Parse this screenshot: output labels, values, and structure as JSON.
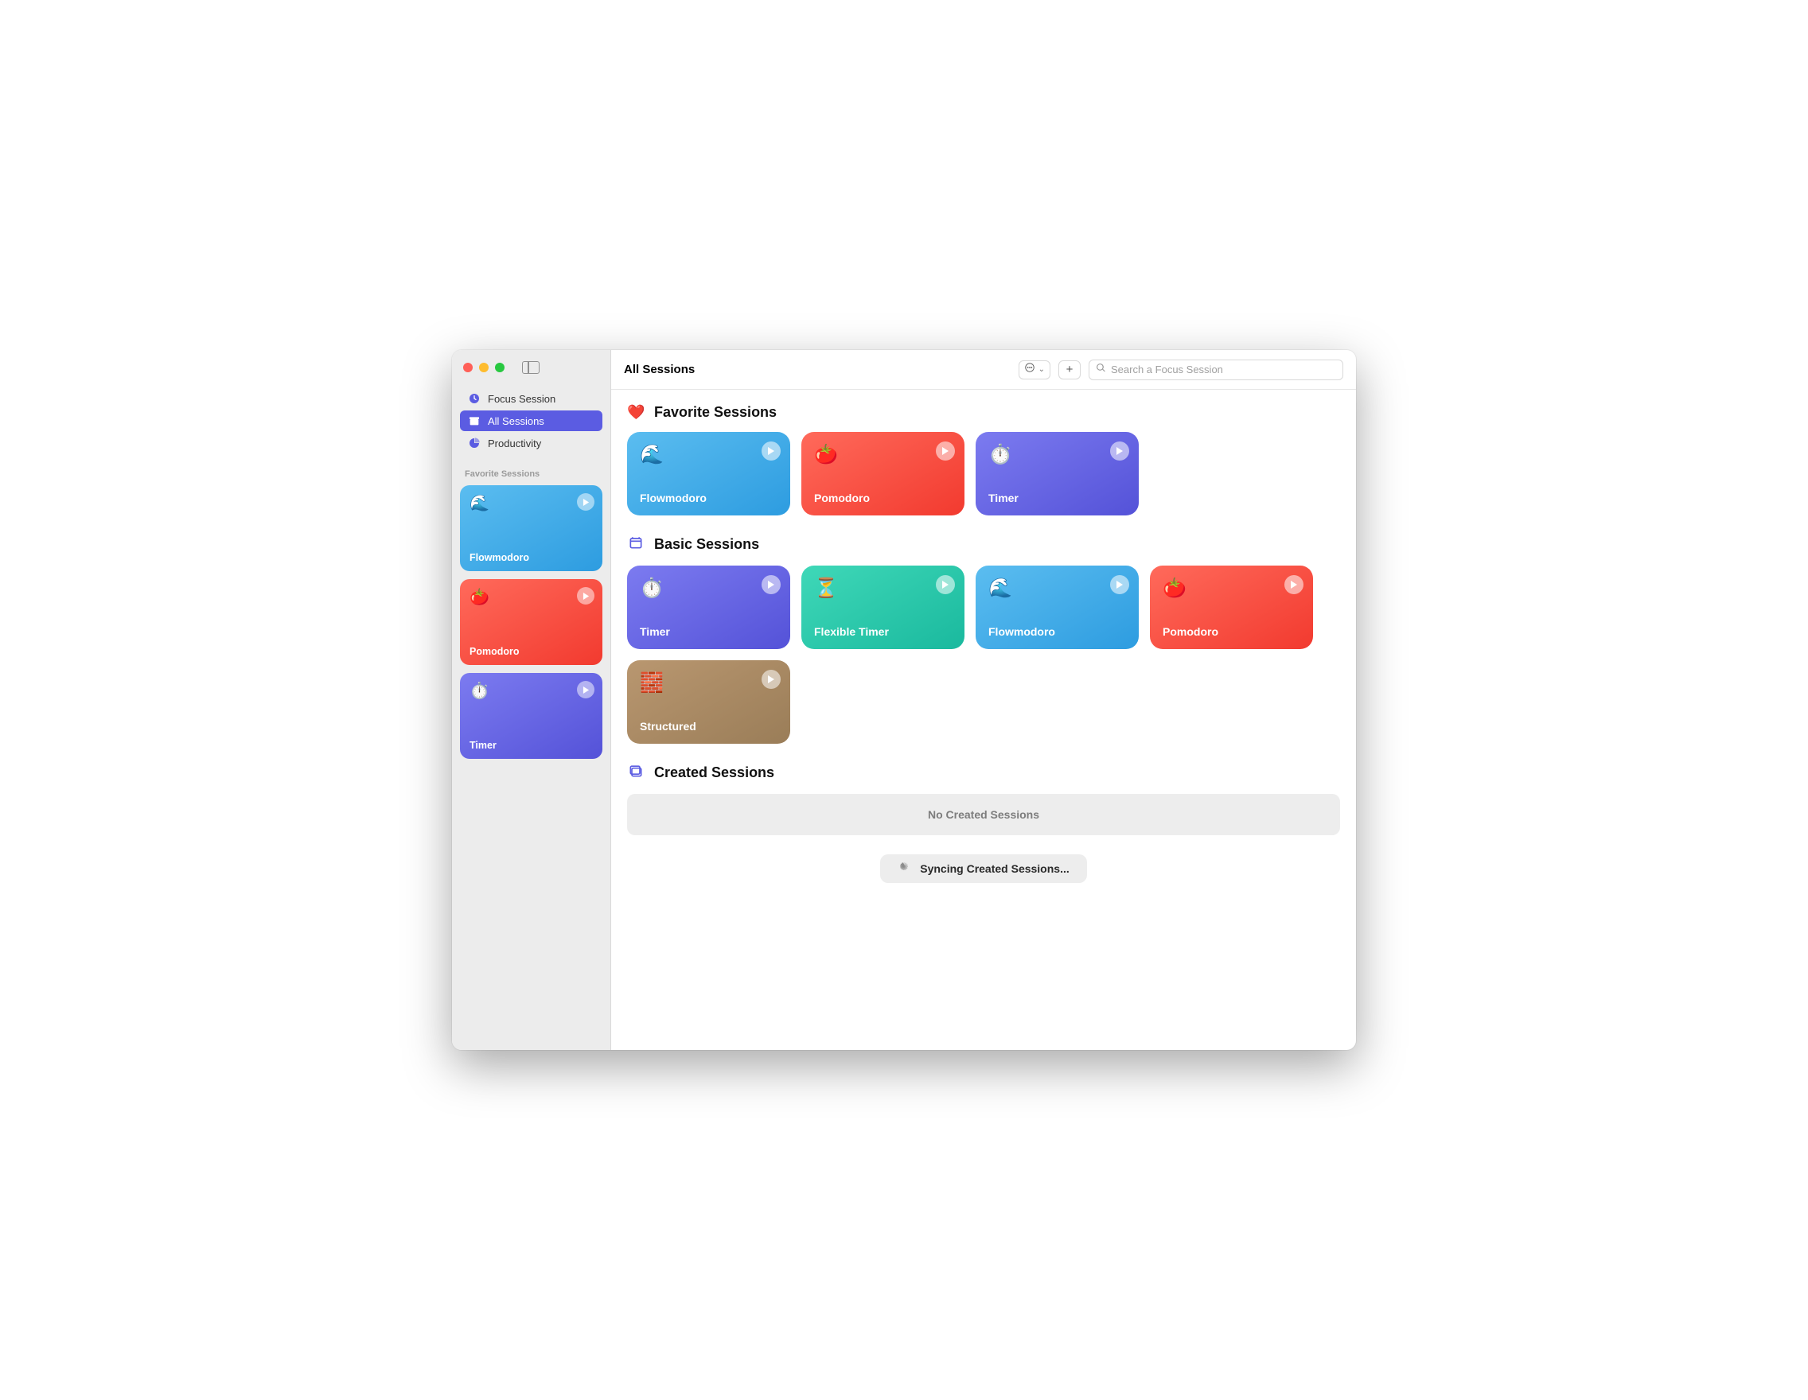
{
  "window": {
    "title": "All Sessions"
  },
  "toolbar": {
    "search_placeholder": "Search a Focus Session"
  },
  "sidebar": {
    "nav": [
      {
        "label": "Focus Session",
        "icon": "clock"
      },
      {
        "label": "All Sessions",
        "icon": "archivebox",
        "active": true
      },
      {
        "label": "Productivity",
        "icon": "piechart"
      }
    ],
    "favorites_header": "Favorite Sessions",
    "favorites": [
      {
        "label": "Flowmodoro",
        "emoji": "🌊",
        "gradient": "g-blue"
      },
      {
        "label": "Pomodoro",
        "emoji": "🍅",
        "gradient": "g-red"
      },
      {
        "label": "Timer",
        "emoji": "⏱️",
        "gradient": "g-indigo"
      }
    ]
  },
  "sections": {
    "favorite": {
      "title": "Favorite Sessions",
      "icon": "heart",
      "cards": [
        {
          "label": "Flowmodoro",
          "emoji": "🌊",
          "gradient": "g-blue"
        },
        {
          "label": "Pomodoro",
          "emoji": "🍅",
          "gradient": "g-red"
        },
        {
          "label": "Timer",
          "emoji": "⏱️",
          "gradient": "g-indigo"
        }
      ]
    },
    "basic": {
      "title": "Basic Sessions",
      "icon": "browser",
      "cards": [
        {
          "label": "Timer",
          "emoji": "⏱️",
          "gradient": "g-indigo"
        },
        {
          "label": "Flexible Timer",
          "emoji": "⏳",
          "gradient": "g-teal"
        },
        {
          "label": "Flowmodoro",
          "emoji": "🌊",
          "gradient": "g-blue"
        },
        {
          "label": "Pomodoro",
          "emoji": "🍅",
          "gradient": "g-red"
        },
        {
          "label": "Structured",
          "emoji": "🧱",
          "gradient": "g-brown"
        }
      ]
    },
    "created": {
      "title": "Created Sessions",
      "icon": "stack",
      "empty_text": "No Created Sessions",
      "syncing_text": "Syncing Created Sessions..."
    }
  }
}
